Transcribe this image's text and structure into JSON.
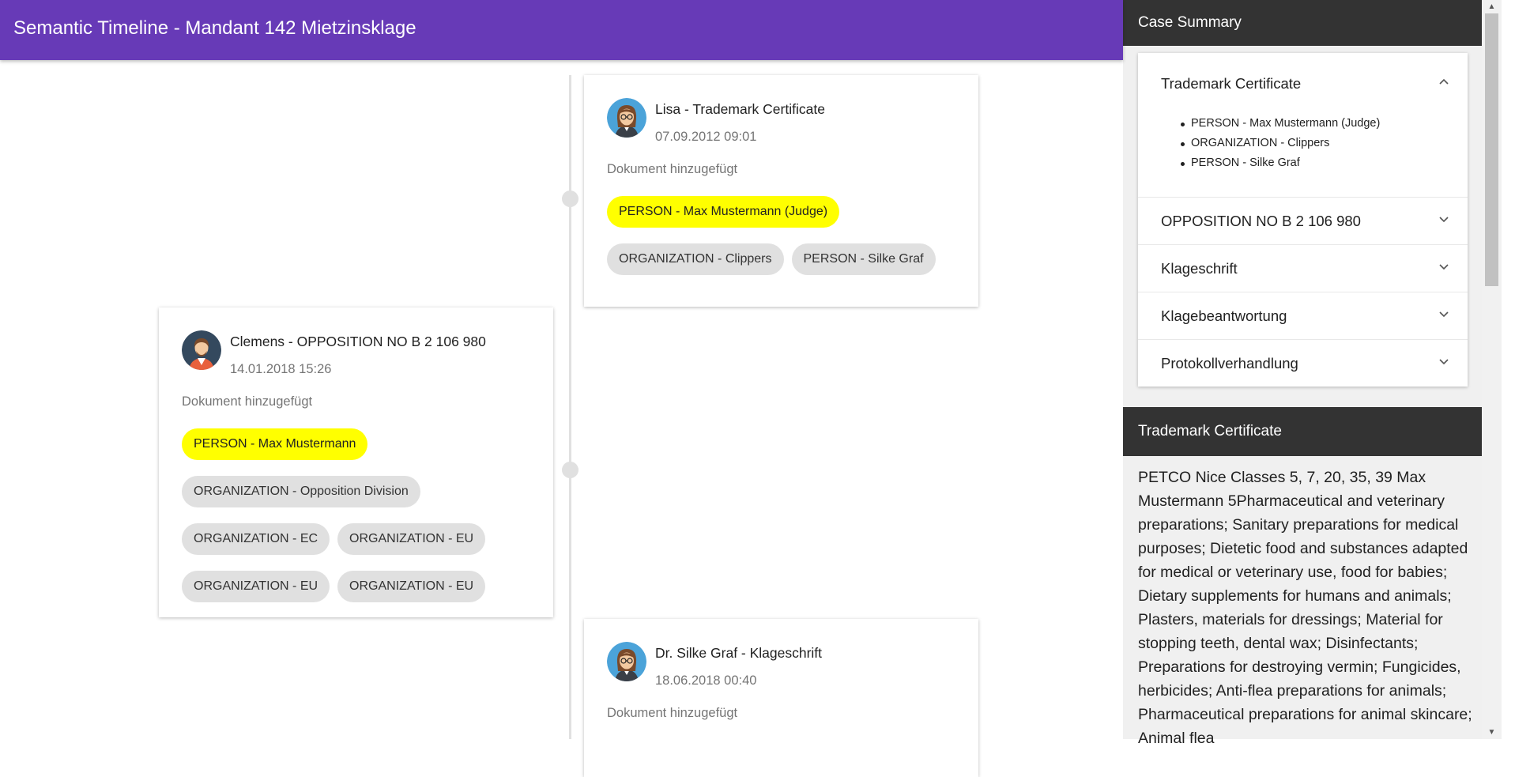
{
  "header": {
    "title": "Semantic Timeline - Mandant 142 Mietzinsklage"
  },
  "timeline": {
    "events": [
      {
        "title": "Lisa - Trademark Certificate",
        "date": "07.09.2012 09:01",
        "description": "Dokument hinzugefügt",
        "avatar_icon": "female-avatar-icon",
        "chips": [
          {
            "label": "PERSON - Max Mustermann (Judge)",
            "highlighted": true
          },
          {
            "label": "ORGANIZATION - Clippers",
            "highlighted": false
          },
          {
            "label": "PERSON - Silke Graf",
            "highlighted": false
          }
        ]
      },
      {
        "title": "Clemens - OPPOSITION NO B 2 106 980",
        "date": "14.01.2018 15:26",
        "description": "Dokument hinzugefügt",
        "avatar_icon": "male-avatar-icon",
        "chips": [
          {
            "label": "PERSON - Max Mustermann",
            "highlighted": true
          },
          {
            "label": "ORGANIZATION - Opposition Division",
            "highlighted": false
          },
          {
            "label": "ORGANIZATION - EC",
            "highlighted": false
          },
          {
            "label": "ORGANIZATION - EU",
            "highlighted": false
          },
          {
            "label": "ORGANIZATION - EU",
            "highlighted": false
          },
          {
            "label": "ORGANIZATION - EU",
            "highlighted": false
          }
        ]
      },
      {
        "title": "Dr. Silke Graf - Klageschrift",
        "date": "18.06.2018 00:40",
        "description": "Dokument hinzugefügt",
        "avatar_icon": "female-avatar-icon"
      }
    ]
  },
  "case_summary": {
    "heading": "Case Summary",
    "sections": [
      {
        "label": "Trademark Certificate",
        "expanded": true,
        "items": [
          "PERSON - Max Mustermann (Judge)",
          "ORGANIZATION - Clippers",
          "PERSON - Silke Graf"
        ]
      },
      {
        "label": "OPPOSITION NO B 2 106 980",
        "expanded": false
      },
      {
        "label": "Klageschrift",
        "expanded": false
      },
      {
        "label": "Klagebeantwortung",
        "expanded": false
      },
      {
        "label": "Protokollverhandlung",
        "expanded": false
      }
    ]
  },
  "document": {
    "heading": "Trademark Certificate",
    "text": "PETCO Nice Classes 5, 7, 20, 35, 39 Max Mustermann 5Pharmaceutical and veterinary preparations; Sanitary preparations for medical purposes; Dietetic food and substances adapted for medical or veterinary use, food for babies; Dietary supplements for humans and animals; Plasters, materials for dressings; Material for stopping teeth, dental wax; Disinfectants; Preparations for destroying vermin; Fungicides, herbicides; Anti-flea preparations for animals; Pharmaceutical preparations for animal skincare; Animal flea"
  },
  "colors": {
    "appbar": "#673ab7",
    "highlight_chip": "#ffff00",
    "chip": "#e0e0e0",
    "panel_header": "#333333",
    "panel_bg": "#f0f0f0"
  }
}
